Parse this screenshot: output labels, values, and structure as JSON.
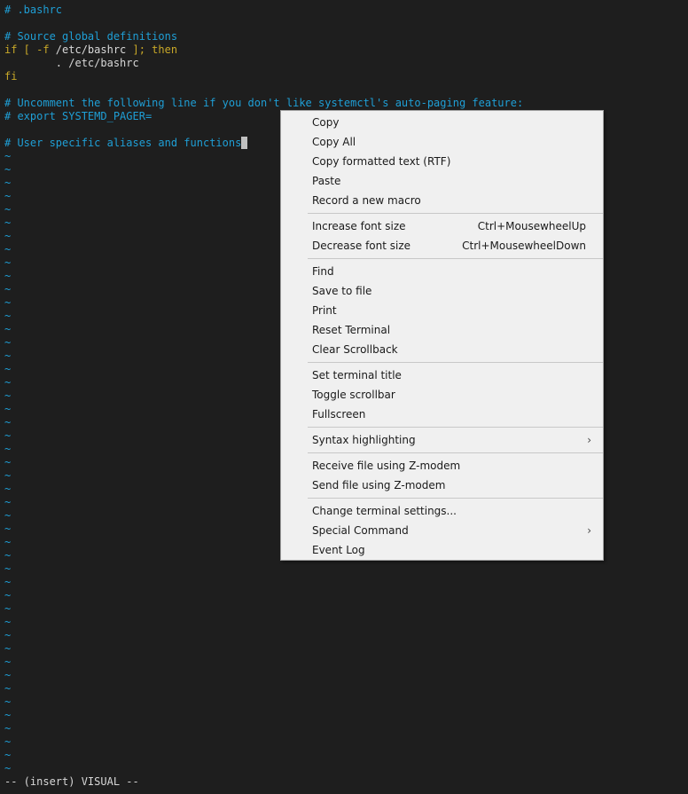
{
  "editor": {
    "lines": {
      "l1": "# .bashrc",
      "l3": "# Source global definitions",
      "l4_kw1": "if [ -f ",
      "l4_path": "/etc/bashrc",
      "l4_kw2": " ]; then",
      "l5": "        . /etc/bashrc",
      "l6": "fi",
      "l8": "# Uncomment the following line if you don't like systemctl's auto-paging feature:",
      "l9": "# export SYSTEMD_PAGER=",
      "l11": "# User specific aliases and functions"
    },
    "tilde": "~",
    "status": "-- (insert) VISUAL --"
  },
  "menu": {
    "copy": "Copy",
    "copy_all": "Copy All",
    "copy_rtf": "Copy formatted text (RTF)",
    "paste": "Paste",
    "record_macro": "Record a new macro",
    "increase_font": "Increase font size",
    "increase_font_sc": "Ctrl+MousewheelUp",
    "decrease_font": "Decrease font size",
    "decrease_font_sc": "Ctrl+MousewheelDown",
    "find": "Find",
    "save_to_file": "Save to file",
    "print": "Print",
    "reset_terminal": "Reset Terminal",
    "clear_scrollback": "Clear Scrollback",
    "set_title": "Set terminal title",
    "toggle_scrollbar": "Toggle scrollbar",
    "fullscreen": "Fullscreen",
    "syntax_highlighting": "Syntax highlighting",
    "receive_zmodem": "Receive file using Z-modem",
    "send_zmodem": "Send file using Z-modem",
    "change_settings": "Change terminal settings...",
    "special_command": "Special Command",
    "event_log": "Event Log",
    "submenu_arrow": "›"
  },
  "colors": {
    "background": "#1e1e1e",
    "comment": "#1f9fd6",
    "keyword": "#c8a828",
    "menu_bg": "#f0f0f0"
  }
}
